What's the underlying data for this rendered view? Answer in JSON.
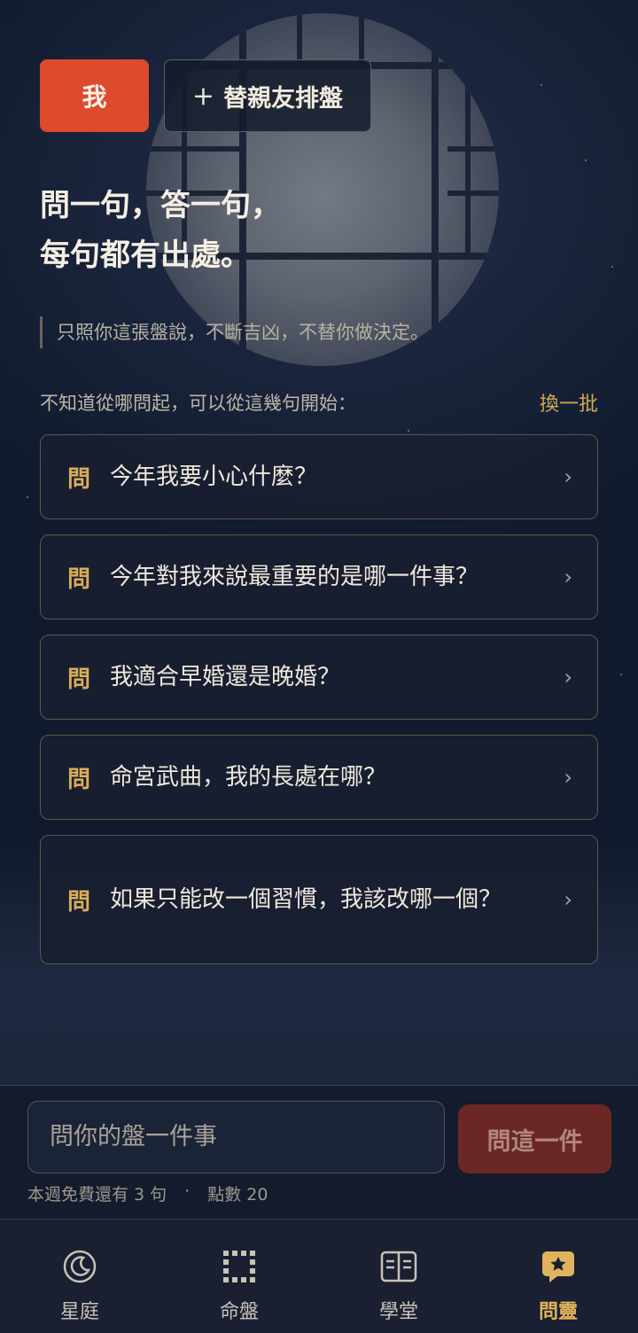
{
  "profile_tabs": {
    "me_label": "我",
    "add_plus": "+",
    "add_label": "替親友排盤"
  },
  "headline": {
    "line1": "問一句，答一句，",
    "line2": "每句都有出處。"
  },
  "subtitle": "只照你這張盤說，不斷吉凶，不替你做決定。",
  "prompt": {
    "text": "不知道從哪問起，可以從這幾句開始：",
    "refresh_label": "換一批"
  },
  "questions": {
    "tag": "問",
    "items": [
      {
        "text": "今年我要小心什麼？"
      },
      {
        "text": "今年對我來說最重要的是哪一件事？"
      },
      {
        "text": "我適合早婚還是晚婚？"
      },
      {
        "text": "命宮武曲，我的長處在哪？"
      },
      {
        "text": "如果只能改一個習慣，我該改哪一個？"
      }
    ],
    "chevron": "›"
  },
  "composer": {
    "placeholder": "問你的盤一件事",
    "submit_label": "問這一件",
    "quota_text": "本週免費還有 3 句",
    "separator": "·",
    "points_text": "點數 20"
  },
  "nav": {
    "items": [
      {
        "label": "星庭",
        "icon": "moon-icon"
      },
      {
        "label": "命盤",
        "icon": "grid-chart-icon"
      },
      {
        "label": "學堂",
        "icon": "book-icon"
      },
      {
        "label": "問靈",
        "icon": "chat-bubble-icon"
      }
    ],
    "active_color": "#e0b45c"
  }
}
